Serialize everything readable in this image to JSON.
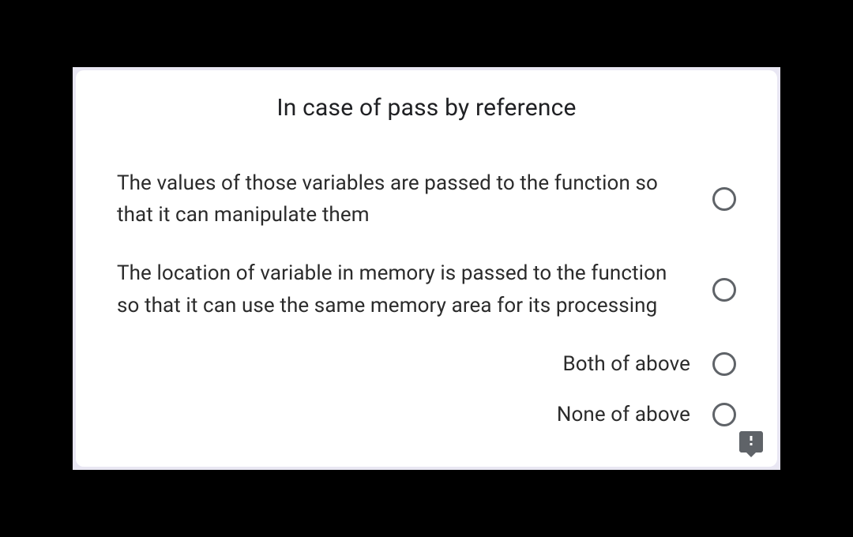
{
  "question": {
    "title": "In case of pass by reference",
    "options": [
      "The values of those variables are passed to the function so that it can manipulate them",
      "The location of variable in memory is passed to the function so that it can use the same memory area for its processing",
      "Both of above",
      "None of above"
    ]
  }
}
